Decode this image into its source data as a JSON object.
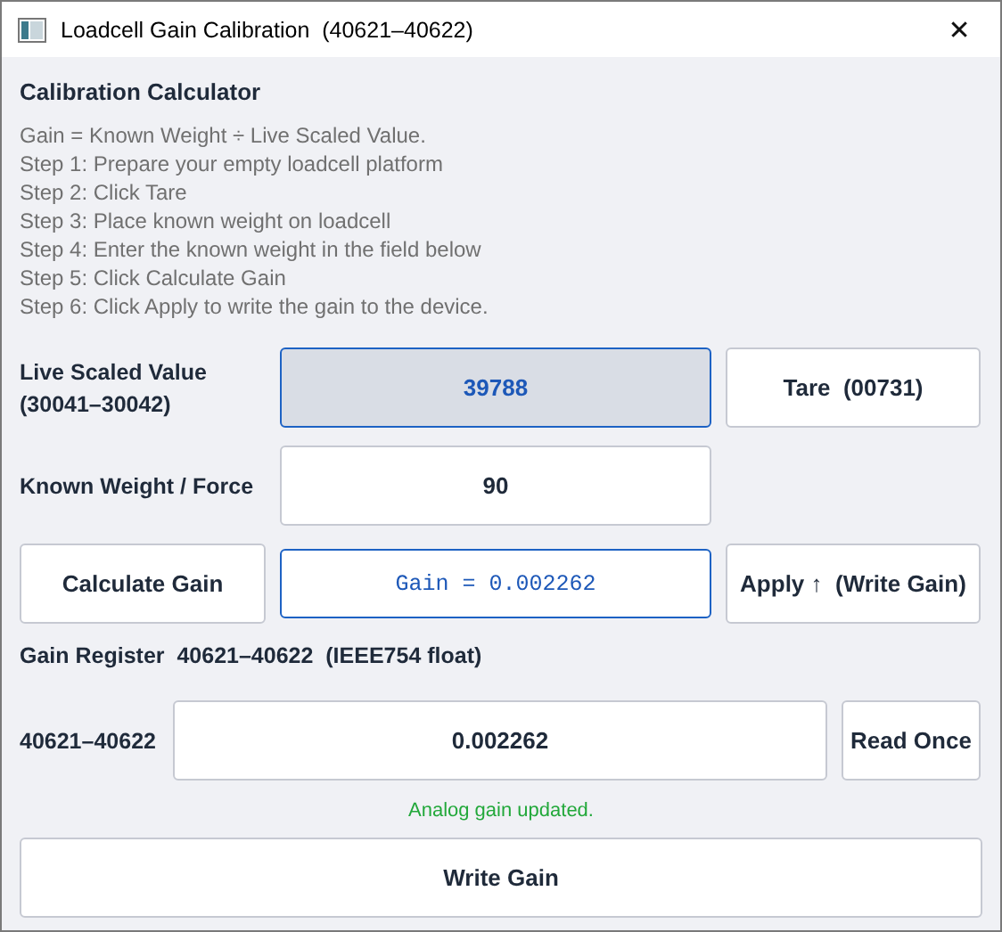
{
  "window": {
    "title": "Loadcell Gain Calibration  (40621–40622)",
    "close": "✕"
  },
  "calculator": {
    "heading": "Calibration Calculator",
    "instructions": [
      "Gain = Known Weight ÷ Live Scaled Value.",
      "Step 1: Prepare your empty loadcell platform",
      "Step 2: Click Tare",
      "Step 3: Place known weight on loadcell",
      "Step 4: Enter the known weight in the field below",
      "Step 5: Click Calculate Gain",
      "Step 6: Click Apply to write the gain to the device."
    ]
  },
  "live": {
    "label": "Live Scaled Value",
    "sublabel": "(30041–30042)",
    "value": "39788",
    "readonly": true
  },
  "tare_button": "Tare  (00731)",
  "known": {
    "label": "Known Weight / Force",
    "value": "90",
    "readonly": false
  },
  "calculate_button": "Calculate Gain",
  "result": "Gain = 0.002262",
  "apply_button": "Apply ↑  (Write Gain)",
  "register": {
    "heading": "Gain Register  40621–40622  (IEEE754 float)",
    "label": "40621–40622",
    "value": "0.002262"
  },
  "read_button": "Read Once",
  "status": {
    "text": "Analog gain updated.",
    "kind": "success"
  },
  "write_button": "Write Gain"
}
